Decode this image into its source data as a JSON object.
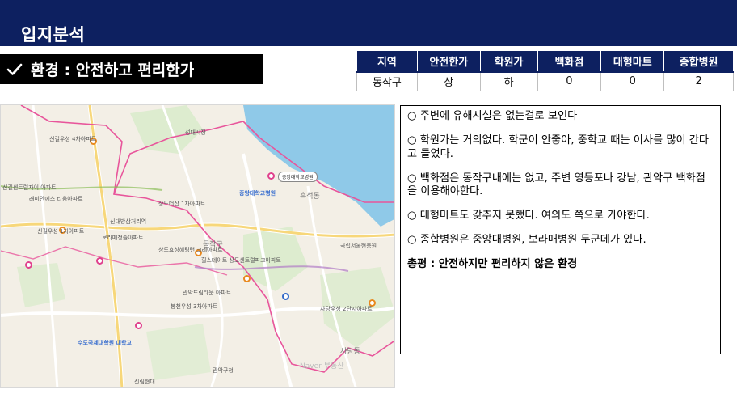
{
  "header": {
    "title": "입지분석"
  },
  "section": {
    "title": "환경 : 안전하고 편리한가"
  },
  "table": {
    "headers": [
      "지역",
      "안전한가",
      "학원가",
      "백화점",
      "대형마트",
      "종합병원"
    ],
    "row": [
      "동작구",
      "상",
      "하",
      "0",
      "0",
      "2"
    ]
  },
  "map": {
    "labels": [
      "신길우성 4차아파트",
      "신길우성 1차아파트",
      "신길센트럴자이 아파트",
      "래미안에스 티움아파트",
      "상도더샵 1차아파트",
      "성대시장",
      "중앙대학교병원",
      "동작구",
      "흑석동",
      "신대방삼거리역",
      "보라매청솔아파트",
      "상도효성해링턴 크레아파트",
      "힐스테이트 상도센트럴파크아파트",
      "관악드림타운 아파트",
      "봉천우성 3차아파트",
      "수도국제대학원 대학교",
      "관악구청",
      "사당우성 2단지아파트",
      "국립서울현충원",
      "사당동",
      "신림현대"
    ],
    "callout": "중앙대학교병원",
    "watermark": "Naver 부동산"
  },
  "notes": [
    "○ 주변에 유해시설은 없는걸로 보인다",
    "○ 학원가는 거의없다. 학군이 안좋아, 중학교 때는 이사를 많이 간다고 들었다.",
    "○ 백화점은 동작구내에는 없고, 주변 영등포나 강남, 관악구 백화점을 이용해야한다.",
    "○ 대형마트도 갖추지 못했다. 여의도 쪽으로 가야한다.",
    "○ 종합병원은 중앙대병원, 보라매병원 두군데가 있다."
  ],
  "summary": "총평 : 안전하지만 편리하지 않은 환경",
  "colors": {
    "navy": "#0d2060",
    "map_bg": "#f3efe6",
    "river": "#8fc9e8",
    "boundary": "#e8559b"
  }
}
